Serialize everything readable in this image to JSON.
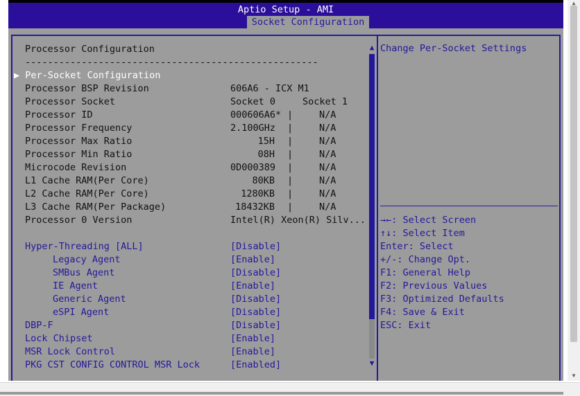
{
  "header": {
    "title": "Aptio Setup - AMI",
    "tab": "Socket Configuration"
  },
  "main": {
    "section_title": "Processor Configuration",
    "rule": "----------------------------------------------------",
    "submenu": {
      "label": "Per-Socket Configuration"
    },
    "socket_headers": {
      "s0": "Socket 0",
      "s1": "Socket 1"
    },
    "info_rows": [
      {
        "label": "Processor BSP Revision",
        "value": "606A6 - ICX M1"
      },
      {
        "label": "Processor Socket"
      },
      {
        "label": "Processor ID",
        "s0": "000606A6*",
        "s1": "N/A"
      },
      {
        "label": "Processor Frequency",
        "s0": "2.100GHz",
        "s1": "N/A"
      },
      {
        "label": "Processor Max Ratio",
        "s0": "15H",
        "s1": "N/A"
      },
      {
        "label": "Processor Min Ratio",
        "s0": "08H",
        "s1": "N/A"
      },
      {
        "label": "Microcode Revision",
        "s0": "0D000389",
        "s1": "N/A"
      },
      {
        "label": "L1 Cache RAM(Per Core)",
        "s0": "80KB",
        "s1": "N/A"
      },
      {
        "label": "L2 Cache RAM(Per Core)",
        "s0": "1280KB",
        "s1": "N/A"
      },
      {
        "label": "L3 Cache RAM(Per Package)",
        "s0": "18432KB",
        "s1": "N/A"
      },
      {
        "label": "Processor 0 Version",
        "value": "Intel(R) Xeon(R) Silv..."
      }
    ],
    "separator": "|",
    "settings": [
      {
        "label": "Hyper-Threading [ALL]",
        "value": "[Disable]"
      },
      {
        "label": "Legacy Agent",
        "value": "[Enable]"
      },
      {
        "label": "SMBus Agent",
        "value": "[Disable]"
      },
      {
        "label": "IE Agent",
        "value": "[Enable]"
      },
      {
        "label": "Generic Agent",
        "value": "[Disable]"
      },
      {
        "label": "eSPI Agent",
        "value": "[Disable]"
      },
      {
        "label": "DBP-F",
        "value": "[Disable]"
      },
      {
        "label": "Lock Chipset",
        "value": "[Enable]"
      },
      {
        "label": "MSR Lock Control",
        "value": "[Enable]"
      },
      {
        "label": "PKG CST CONFIG CONTROL MSR Lock",
        "value": "[Enabled]"
      }
    ]
  },
  "help": {
    "text": "Change Per-Socket Settings",
    "keys": [
      "→←: Select Screen",
      "↑↓: Select Item",
      "Enter: Select",
      "+/-: Change Opt.",
      "F1: General Help",
      "F2: Previous Values",
      "F3: Optimized Defaults",
      "F4: Save & Exit",
      "ESC: Exit"
    ]
  },
  "scrollbar": {
    "thumb_fraction": 0.87
  },
  "colors": {
    "accent": "#24189a",
    "header_bg": "#2b0e9a",
    "panel_bg": "#9c9c9c"
  }
}
